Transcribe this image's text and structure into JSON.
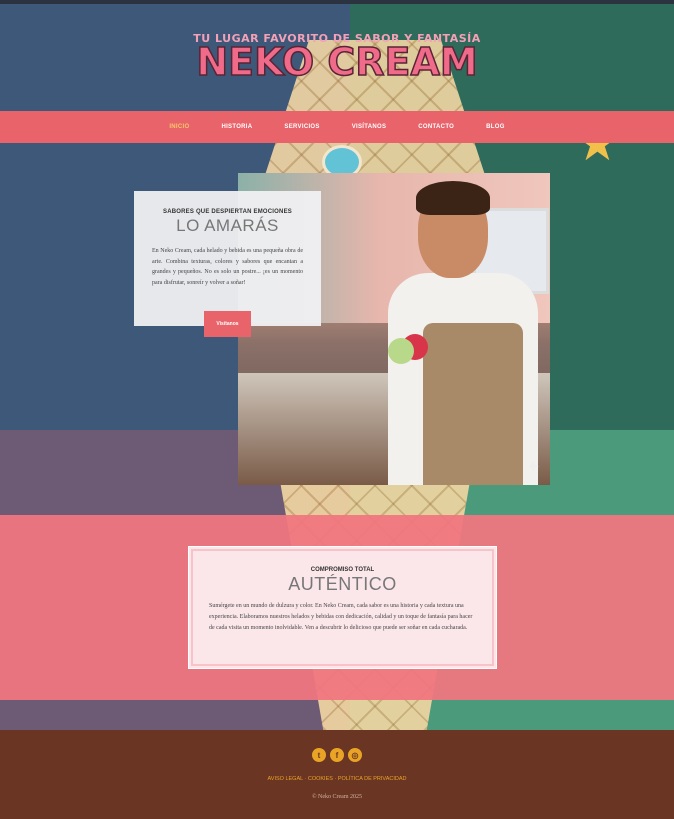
{
  "header": {
    "tagline": "TU LUGAR FAVORITO DE SABOR Y FANTASÍA",
    "brand": "NEKO CREAM"
  },
  "nav": {
    "items": [
      "INICIO",
      "HISTORIA",
      "SERVICIOS",
      "VISÍTANOS",
      "CONTACTO",
      "BLOG"
    ],
    "active": "INICIO"
  },
  "hero": {
    "eyebrow": "SABORES QUE DESPIERTAN EMOCIONES",
    "title": "LO AMARÁS",
    "body": "En Neko Cream, cada helado y bebida es una pequeña obra de arte. Combina texturas, colores y sabores que encantan a grandes y pequeños. No es solo un postre... ¡es un momento para disfrutar, sonreír y volver a soñar!",
    "button": "Visítanos"
  },
  "about": {
    "eyebrow": "COMPROMISO TOTAL",
    "title": "AUTÉNTICO",
    "body": "Sumérgete en un mundo de dulzura y color. En Neko Cream, cada sabor es una historia y cada textura una experiencia. Elaboramos nuestros helados y bebidas con dedicación, calidad y un toque de fantasía para hacer de cada visita un momento inolvidable. Ven a descubrir lo delicioso que puede ser soñar en cada cucharada."
  },
  "footer": {
    "socials": [
      {
        "icon": "twitter-icon",
        "glyph": "t"
      },
      {
        "icon": "facebook-icon",
        "glyph": "f"
      },
      {
        "icon": "instagram-icon",
        "glyph": "◎"
      }
    ],
    "legal": "AVISO LEGAL · COOKIES · POLÍTICA DE PRIVACIDAD",
    "copyright": "© Neko Cream 2025"
  }
}
